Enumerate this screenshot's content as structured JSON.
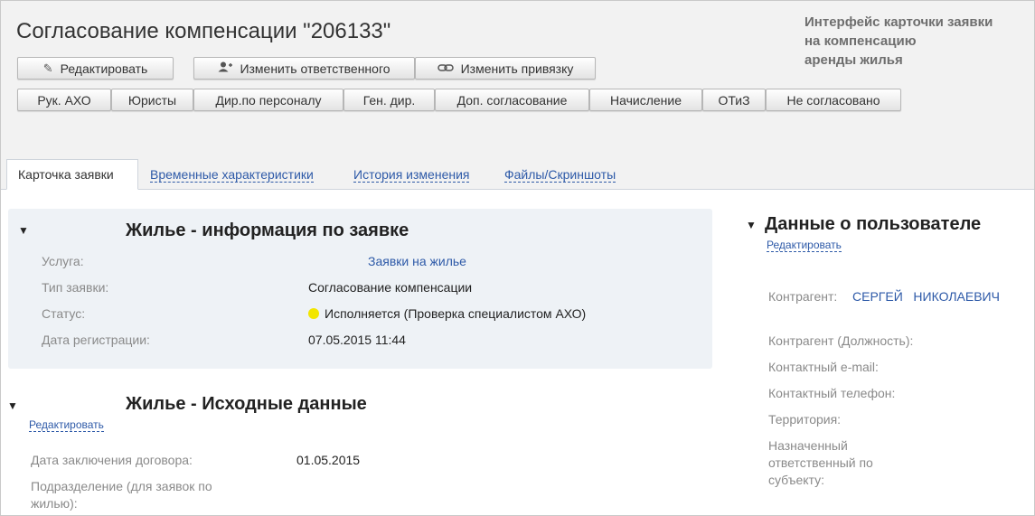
{
  "header": {
    "title": "Согласование компенсации \"206133\"",
    "annotation": [
      "Интерфейс карточки заявки",
      "на компенсацию",
      "аренды жилья"
    ]
  },
  "toolbar": {
    "edit_label": "Редактировать",
    "change_responsible_label": "Изменить ответственного",
    "change_binding_label": "Изменить привязку",
    "icons": {
      "edit": "pencil-icon",
      "responsible": "add-user-icon",
      "binding": "link-icon"
    }
  },
  "approval_buttons": [
    "Рук. АХО",
    "Юристы",
    "Дир.по персоналу",
    "Ген. дир.",
    "Доп. согласование",
    "Начисление",
    "ОТиЗ",
    "Не согласовано"
  ],
  "tabs": [
    {
      "label": "Карточка заявки",
      "active": true
    },
    {
      "label": "Временные характеристики",
      "active": false
    },
    {
      "label": "История изменения",
      "active": false
    },
    {
      "label": "Файлы/Скриншоты",
      "active": false
    }
  ],
  "request_info": {
    "title": "Жилье - информация по заявке",
    "service_label": "Услуга:",
    "service_value": "Заявки на жилье",
    "type_label": "Тип заявки:",
    "type_value": "Согласование компенсации",
    "status_label": "Статус:",
    "status_value": "Исполняется (Проверка специалистом АХО)",
    "status_color": "#f2e600",
    "reg_date_label": "Дата регистрации:",
    "reg_date_value": "07.05.2015 11:44"
  },
  "source_data": {
    "title": "Жилье - Исходные данные",
    "edit_link": "Редактировать",
    "contract_date_label": "Дата заключения договора:",
    "contract_date_value": "01.05.2015",
    "subdivision_label": "Подразделение (для заявок по жилью):"
  },
  "user_data": {
    "title": "Данные о пользователе",
    "edit_link": "Редактировать",
    "contractor_label": "Контрагент:",
    "contractor_value": "СЕРГЕЙ   НИКОЛАЕВИЧ",
    "position_label": "Контрагент (Должность):",
    "email_label": "Контактный e-mail:",
    "phone_label": "Контактный телефон:",
    "territory_label": "Территория:",
    "assigned_label": "Назначенный ответственный по субъекту:"
  },
  "colors": {
    "link": "#2e5aa8",
    "panel_bg": "#eef2f6",
    "header_bg": "#f2f2f2"
  }
}
